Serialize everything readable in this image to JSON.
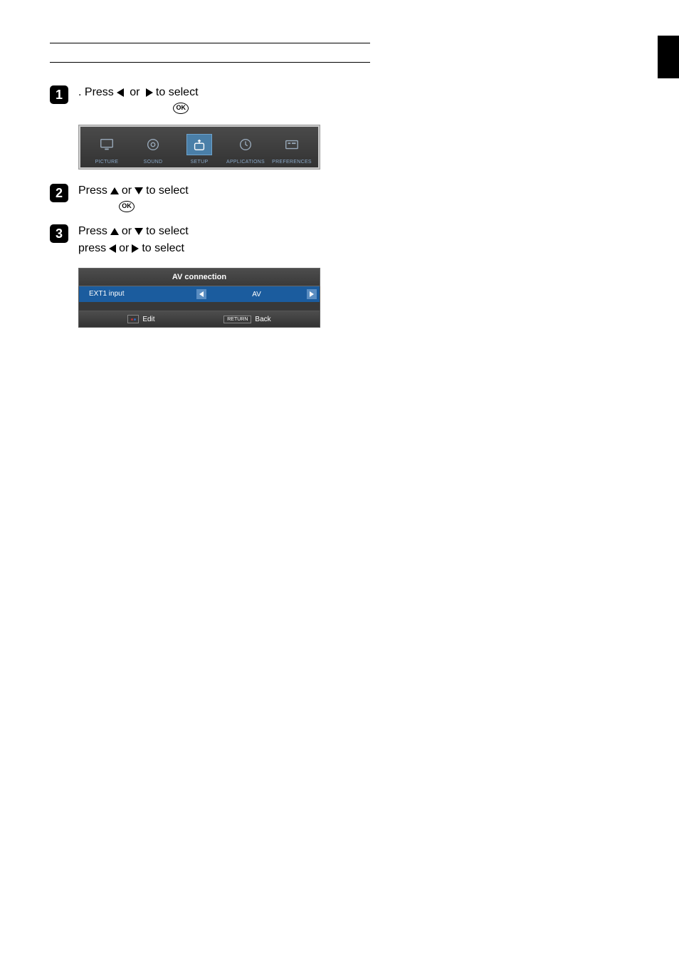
{
  "steps": {
    "step1": {
      "prefix": "",
      "mid": ". Press ",
      "rest": " to select "
    },
    "step2": {
      "prefix": "Press ",
      "mid": " or ",
      "rest": " to select "
    },
    "step3": {
      "line1_prefix": "Press ",
      "line1_mid": " or ",
      "line1_rest": " to select ",
      "line2_prefix": "press ",
      "line2_mid": " or ",
      "line2_rest": " to select "
    }
  },
  "ok_label": "OK",
  "menu": {
    "picture": "PICTURE",
    "sound": "SOUND",
    "setup": "SETUP",
    "applications": "APPLICATIONS",
    "preferences": "PREFERENCES"
  },
  "av_panel": {
    "title": "AV connection",
    "row_label": "EXT1 input",
    "row_value": "AV",
    "edit": "Edit",
    "return": "RETURN",
    "back": "Back"
  }
}
